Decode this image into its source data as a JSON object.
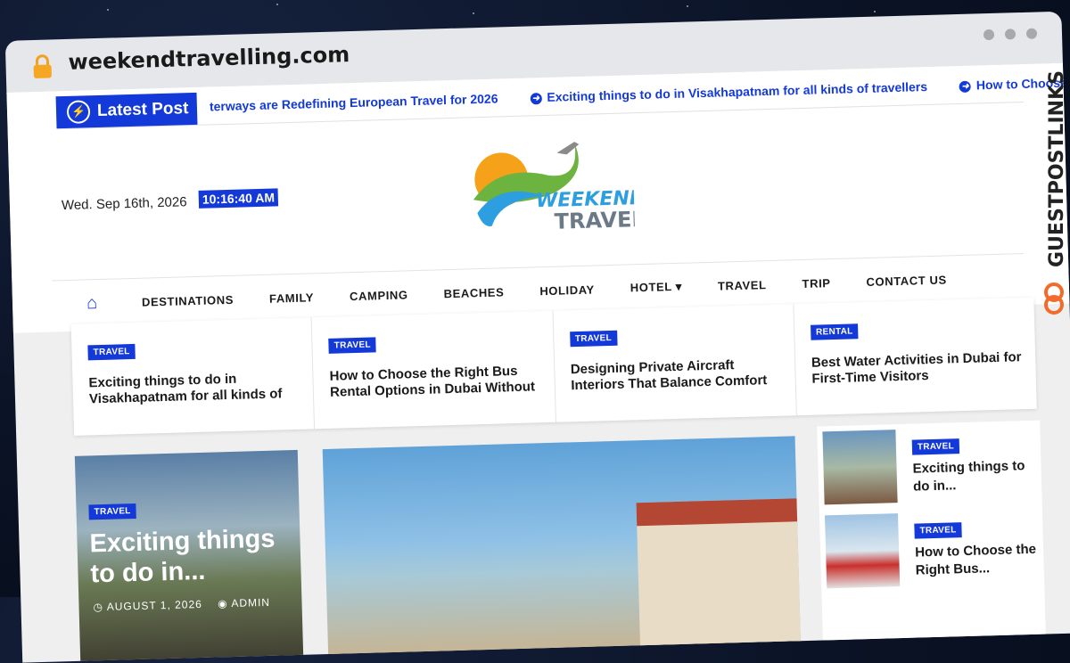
{
  "browser": {
    "url": "weekendtravelling.com"
  },
  "ticker": {
    "label": "Latest Post",
    "items": [
      "terways are Redefining European Travel for 2026",
      "Exciting things to do in Visakhapatnam for all kinds of travellers",
      "How to Choose t"
    ]
  },
  "header": {
    "date": "Wed. Sep 16th, 2026",
    "time": "10:16:40 AM",
    "logo_text_1": "WEEKEND",
    "logo_text_2": "TRAVEL"
  },
  "nav": {
    "items": [
      "DESTINATIONS",
      "FAMILY",
      "CAMPING",
      "BEACHES",
      "HOLIDAY",
      "HOTEL",
      "TRAVEL",
      "TRIP",
      "CONTACT US"
    ]
  },
  "strip": [
    {
      "badge": "TRAVEL",
      "title": "Exciting things to do in Visakhapatnam for all kinds of"
    },
    {
      "badge": "TRAVEL",
      "title": "How to Choose the Right Bus Rental Options in Dubai Without"
    },
    {
      "badge": "TRAVEL",
      "title": "Designing Private Aircraft Interiors That Balance Comfort"
    },
    {
      "badge": "RENTAL",
      "title": "Best Water Activities in Dubai for First-Time Visitors"
    }
  ],
  "featured": {
    "badge": "TRAVEL",
    "title": "Exciting things to do in...",
    "date": "AUGUST 1, 2026",
    "author": "ADMIN"
  },
  "sidebar": [
    {
      "badge": "TRAVEL",
      "title": "Exciting things to do in..."
    },
    {
      "badge": "TRAVEL",
      "title": "How to Choose the Right Bus..."
    }
  ],
  "watermark": "GUESTPOSTLINKS",
  "colors": {
    "accent": "#1339d8",
    "page_bg": "#efefef"
  }
}
